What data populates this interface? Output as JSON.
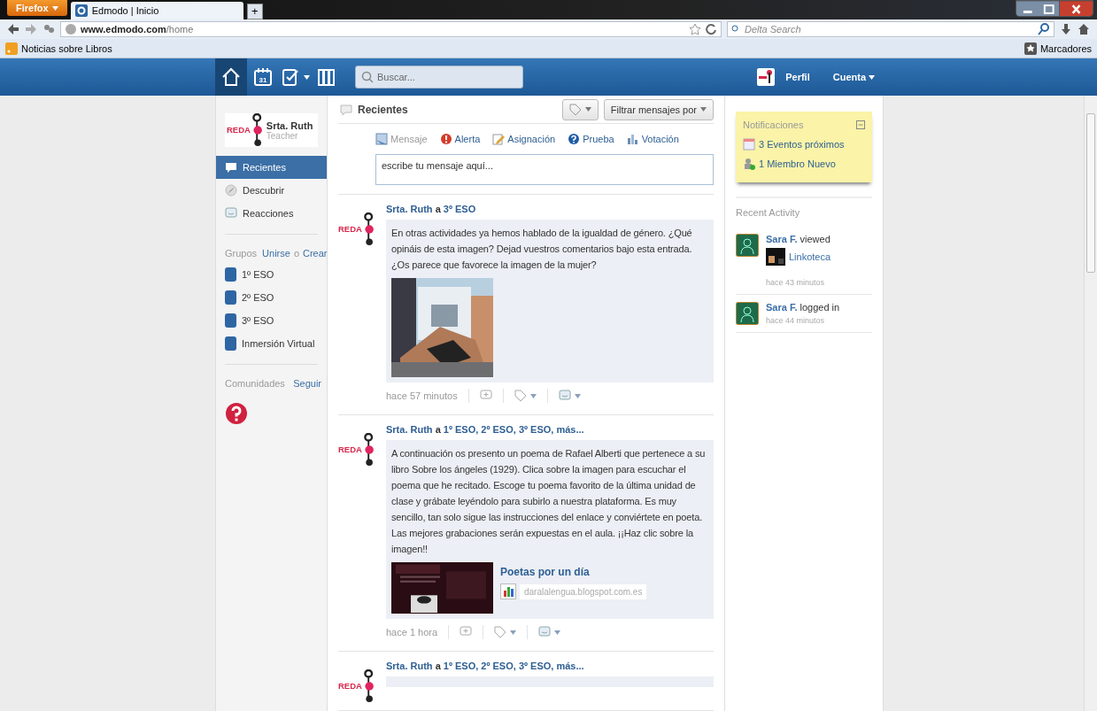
{
  "browser": {
    "app_menu": "Firefox",
    "tab_title": "Edmodo | Inicio",
    "new_tab": "+",
    "url_host": "www.edmodo.com",
    "url_path": "/home",
    "search_placeholder": "Delta Search",
    "bookmark": "Noticias sobre Libros",
    "bookmarks_menu": "Marcadores"
  },
  "topbar": {
    "nav": [
      {
        "kind": "home",
        "selected": true
      },
      {
        "kind": "calendar",
        "label": "31",
        "selected": false
      },
      {
        "kind": "assignments",
        "selected": false
      },
      {
        "kind": "library",
        "selected": false
      }
    ],
    "search_placeholder": "Buscar...",
    "profile": "Perfil",
    "account": "Cuenta"
  },
  "sidebar": {
    "user": {
      "avatar_text": "REDA",
      "name": "Srta. Ruth",
      "role": "Teacher"
    },
    "items": [
      {
        "kind": "speech",
        "label": "Recientes",
        "selected": true
      },
      {
        "kind": "compass",
        "label": "Descubrir",
        "selected": false
      },
      {
        "kind": "smile",
        "label": "Reacciones",
        "selected": false
      }
    ],
    "groups_heading": "Grupos",
    "join": "Unirse",
    "join_connector": "o",
    "create": "Crear",
    "groups": [
      {
        "label": "1º ESO"
      },
      {
        "label": "2º ESO"
      },
      {
        "label": "3º ESO"
      },
      {
        "label": "Inmersión Virtual"
      }
    ],
    "communities_heading": "Comunidades",
    "follow": "Seguir"
  },
  "feed": {
    "title": "Recientes",
    "filter": "Filtrar mensajes por",
    "composer_tabs": [
      {
        "kind": "message",
        "label": "Mensaje",
        "selected": true
      },
      {
        "kind": "alert",
        "label": "Alerta",
        "selected": false
      },
      {
        "kind": "assignment",
        "label": "Asignación",
        "selected": false
      },
      {
        "kind": "quiz",
        "label": "Prueba",
        "selected": false
      },
      {
        "kind": "poll",
        "label": "Votación",
        "selected": false
      }
    ],
    "composer_placeholder": "escribe tu mensaje aquí...",
    "posts": [
      {
        "avatar_text": "REDA",
        "author": "Srta. Ruth",
        "connector": "a",
        "recipients": "3º ESO",
        "body": "En otras actividades ya hemos hablado de la igualdad de género. ¿Qué opináis de esta imagen? Dejad vuestros comentarios bajo esta entrada. ¿Os parece que favorece la imagen de la mujer?",
        "time": "hace 57 minutos"
      },
      {
        "avatar_text": "REDA",
        "author": "Srta. Ruth",
        "connector": "a",
        "recipients": "1º ESO, 2º ESO, 3º ESO, más...",
        "body": "A continuación os presento un poema de Rafael Alberti que pertenece a su libro Sobre los ángeles (1929). Clica sobre la imagen para escuchar el poema que he recitado. Escoge tu poema favorito de la última unidad de clase y grábate leyéndolo para subirlo a nuestra plataforma. Es muy sencillo, tan solo sigue las instrucciones del enlace y conviértete en poeta. Las mejores grabaciones serán expuestas en el aula. ¡¡Haz clic sobre la imagen!!",
        "link": {
          "title": "Poetas por un día",
          "domain": "daralalengua.blogspot.com.es"
        },
        "time": "hace 1 hora"
      },
      {
        "avatar_text": "REDA",
        "author": "Srta. Ruth",
        "connector": "a",
        "recipients": "1º ESO, 2º ESO, 3º ESO, más..."
      }
    ]
  },
  "notifications": {
    "title": "Notificaciones",
    "items": [
      {
        "kind": "calendar",
        "label": "3 Eventos próximos"
      },
      {
        "kind": "member",
        "label": "1 Miembro Nuevo"
      }
    ]
  },
  "recent_activity": {
    "title": "Recent Activity",
    "items": [
      {
        "user": "Sara F.",
        "action": "viewed",
        "link": "Linkoteca",
        "time": "hace 43 minutos"
      },
      {
        "user": "Sara F.",
        "action": "logged in",
        "time": "hace 44 minutos"
      }
    ]
  }
}
